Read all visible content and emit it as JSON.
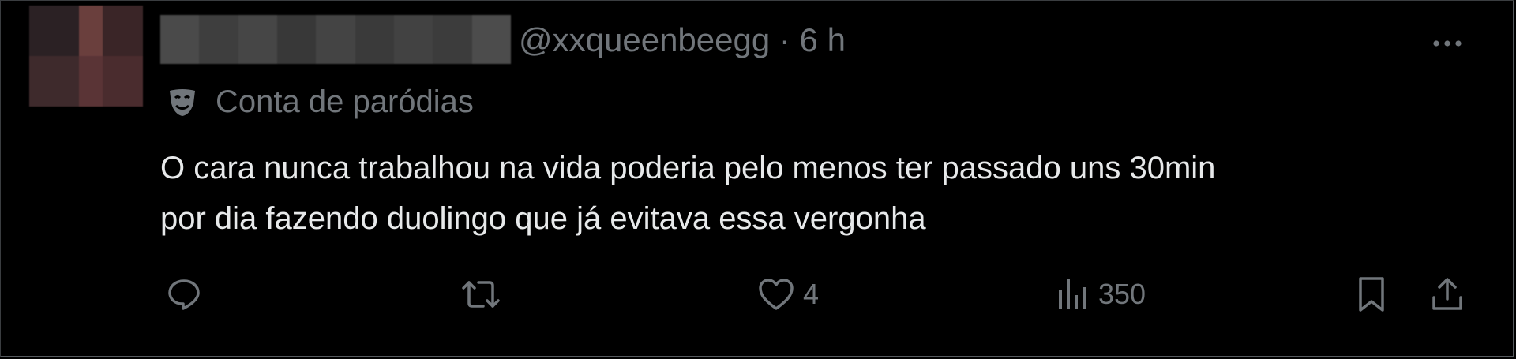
{
  "tweet": {
    "handle_time": "@xxqueenbeegg · 6 h",
    "parody_label": "Conta de paródias",
    "text_lines": [
      "O cara nunca trabalhou na vida poderia pelo menos ter passado uns 30min",
      "por dia fazendo duolingo que já evitava essa vergonha"
    ],
    "icons": {
      "more": "more-horizontal-icon",
      "parody": "theater-mask-icon",
      "reply": "reply-icon",
      "retweet": "retweet-icon",
      "like": "heart-icon",
      "views": "bar-chart-icon",
      "bookmark": "bookmark-icon",
      "share": "share-icon"
    },
    "metrics": {
      "likes": "4",
      "views": "350"
    }
  },
  "colors": {
    "background": "#000000",
    "text_primary": "#e7e9ea",
    "text_secondary": "#71767b"
  }
}
